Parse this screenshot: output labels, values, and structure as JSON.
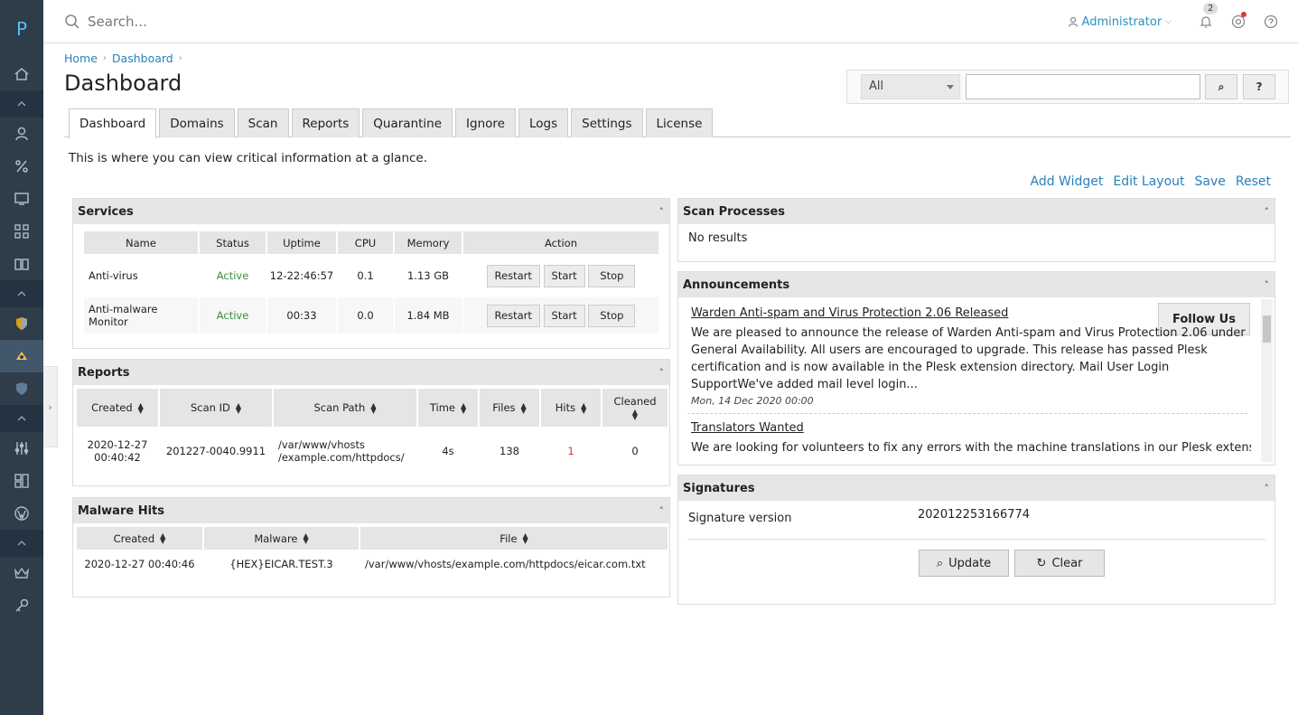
{
  "sidebar": {
    "logo": "P"
  },
  "topbar": {
    "search_placeholder": "Search...",
    "user": "Administrator",
    "notification_count": "2"
  },
  "breadcrumb": [
    "Home",
    "Dashboard"
  ],
  "page_title": "Dashboard",
  "filter": {
    "select_value": "All",
    "search_btn": "⌕",
    "help_btn": "?"
  },
  "tabs": [
    "Dashboard",
    "Domains",
    "Scan",
    "Reports",
    "Quarantine",
    "Ignore",
    "Logs",
    "Settings",
    "License"
  ],
  "intro": "This is where you can view critical information at a glance.",
  "actions": [
    "Add Widget",
    "Edit Layout",
    "Save",
    "Reset"
  ],
  "services": {
    "title": "Services",
    "columns": [
      "Name",
      "Status",
      "Uptime",
      "CPU",
      "Memory",
      "Action"
    ],
    "rows": [
      {
        "name": "Anti-virus",
        "status": "Active",
        "uptime": "12-22:46:57",
        "cpu": "0.1",
        "memory": "1.13 GB"
      },
      {
        "name": "Anti-malware Monitor",
        "status": "Active",
        "uptime": "00:33",
        "cpu": "0.0",
        "memory": "1.84 MB"
      }
    ],
    "buttons": {
      "restart": "Restart",
      "start": "Start",
      "stop": "Stop"
    }
  },
  "reports": {
    "title": "Reports",
    "columns": [
      "Created",
      "Scan ID",
      "Scan Path",
      "Time",
      "Files",
      "Hits",
      "Cleaned"
    ],
    "rows": [
      {
        "created_date": "2020-12-27",
        "created_time": "00:40:42",
        "scan_id": "201227-0040.9911",
        "path1": "/var/www/vhosts",
        "path2": "/example.com/httpdocs/",
        "time": "4s",
        "files": "138",
        "hits": "1",
        "cleaned": "0"
      }
    ]
  },
  "malware": {
    "title": "Malware Hits",
    "columns": [
      "Created",
      "Malware",
      "File"
    ],
    "rows": [
      {
        "created": "2020-12-27 00:40:46",
        "malware": "{HEX}EICAR.TEST.3",
        "file": "/var/www/vhosts/example.com/httpdocs/eicar.com.txt"
      }
    ]
  },
  "scan_processes": {
    "title": "Scan Processes",
    "empty": "No results"
  },
  "announcements": {
    "title": "Announcements",
    "follow": "Follow Us",
    "items": [
      {
        "title": "Warden Anti-spam and Virus Protection 2.06 Released",
        "body": "We are pleased to announce the release of Warden Anti-spam and Virus Protection 2.06 under General Availability. All users are encouraged to upgrade. This release has passed Plesk certification and is now available in the Plesk extension directory. Mail User Login SupportWe've added mail level login...",
        "date": "Mon, 14 Dec 2020 00:00"
      },
      {
        "title": "Translators Wanted",
        "body": "We are looking for volunteers to fix any errors with the machine translations in our Plesk extensions"
      }
    ]
  },
  "signatures": {
    "title": "Signatures",
    "label": "Signature version",
    "version": "202012253166774",
    "update": "Update",
    "clear": "Clear"
  }
}
